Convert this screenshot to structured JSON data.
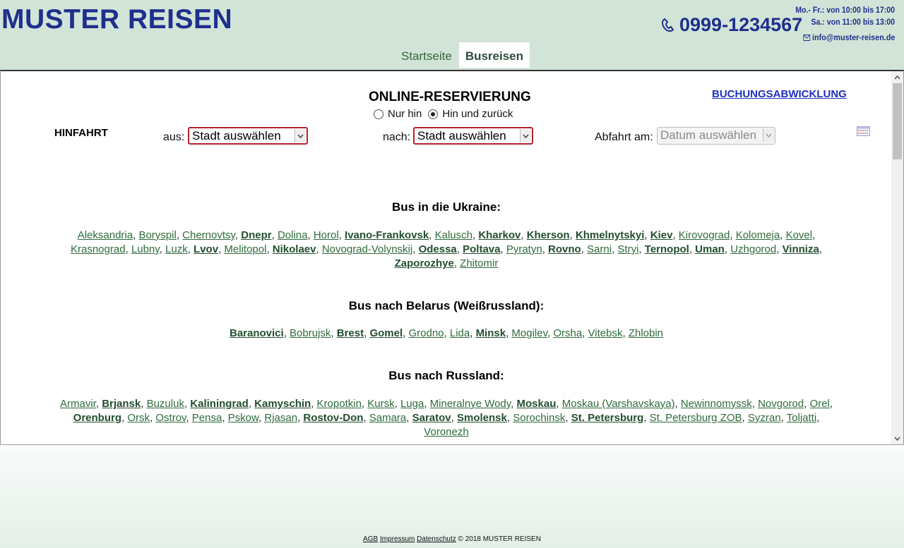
{
  "header": {
    "logo": "MUSTER REISEN",
    "phone": "0999-1234567",
    "hours_weekday": "Mo.- Fr.: von 10:00 bis 17:00",
    "hours_saturday": "Sa.: von 11:00 bis 13:00",
    "email": "info@muster-reisen.de",
    "tabs": [
      {
        "label": "Startseite",
        "active": false
      },
      {
        "label": "Busreisen",
        "active": true
      }
    ]
  },
  "reservation": {
    "title": "ONLINE-RESERVIERUNG",
    "booking_link": "BUCHUNGSABWICKLUNG",
    "trip_options": [
      {
        "label": "Nur hin",
        "checked": false
      },
      {
        "label": "Hin und zurück",
        "checked": true
      }
    ],
    "direction_label": "HINFAHRT",
    "from_label": "aus:",
    "from_value": "Stadt auswählen",
    "to_label": "nach:",
    "to_value": "Stadt auswählen",
    "date_label": "Abfahrt am:",
    "date_value": "Datum auswählen",
    "select_border_color": "#b3242d"
  },
  "sections": [
    {
      "title": "Bus in die Ukraine:",
      "cities": [
        {
          "name": "Aleksandria",
          "bold": false
        },
        {
          "name": "Boryspil",
          "bold": false
        },
        {
          "name": "Chernovtsy",
          "bold": false
        },
        {
          "name": "Dnepr",
          "bold": true
        },
        {
          "name": "Dolina",
          "bold": false
        },
        {
          "name": "Horol",
          "bold": false
        },
        {
          "name": "Ivano-Frankovsk",
          "bold": true
        },
        {
          "name": "Kalusch",
          "bold": false
        },
        {
          "name": "Kharkov",
          "bold": true
        },
        {
          "name": "Kherson",
          "bold": true
        },
        {
          "name": "Khmelnytskyi",
          "bold": true
        },
        {
          "name": "Kiev",
          "bold": true
        },
        {
          "name": "Kirovograd",
          "bold": false
        },
        {
          "name": "Kolomeja",
          "bold": false
        },
        {
          "name": "Kovel",
          "bold": false
        },
        {
          "name": "Krasnograd",
          "bold": false
        },
        {
          "name": "Lubny",
          "bold": false
        },
        {
          "name": "Luzk",
          "bold": false
        },
        {
          "name": "Lvov",
          "bold": true
        },
        {
          "name": "Melitopol",
          "bold": false
        },
        {
          "name": "Nikolaev",
          "bold": true
        },
        {
          "name": "Novograd-Volynskij",
          "bold": false
        },
        {
          "name": "Odessa",
          "bold": true
        },
        {
          "name": "Poltava",
          "bold": true
        },
        {
          "name": "Pyratyn",
          "bold": false
        },
        {
          "name": "Rovno",
          "bold": true
        },
        {
          "name": "Sarni",
          "bold": false
        },
        {
          "name": "Stryi",
          "bold": false
        },
        {
          "name": "Ternopol",
          "bold": true
        },
        {
          "name": "Uman",
          "bold": true
        },
        {
          "name": "Uzhgorod",
          "bold": false
        },
        {
          "name": "Vinniza",
          "bold": true
        },
        {
          "name": "Zaporozhye",
          "bold": true
        },
        {
          "name": "Zhitomir",
          "bold": false
        }
      ]
    },
    {
      "title": "Bus nach Belarus (Weißrussland):",
      "cities": [
        {
          "name": "Baranovici",
          "bold": true
        },
        {
          "name": "Bobrujsk",
          "bold": false
        },
        {
          "name": "Brest",
          "bold": true
        },
        {
          "name": "Gomel",
          "bold": true
        },
        {
          "name": "Grodno",
          "bold": false
        },
        {
          "name": "Lida",
          "bold": false
        },
        {
          "name": "Minsk",
          "bold": true
        },
        {
          "name": "Mogilev",
          "bold": false
        },
        {
          "name": "Orsha",
          "bold": false
        },
        {
          "name": "Vitebsk",
          "bold": false
        },
        {
          "name": "Zhlobin",
          "bold": false
        }
      ]
    },
    {
      "title": "Bus nach Russland:",
      "cities": [
        {
          "name": "Armavir",
          "bold": false
        },
        {
          "name": "Brjansk",
          "bold": true
        },
        {
          "name": "Buzuluk",
          "bold": false
        },
        {
          "name": "Kaliningrad",
          "bold": true
        },
        {
          "name": "Kamyschin",
          "bold": true
        },
        {
          "name": "Kropotkin",
          "bold": false
        },
        {
          "name": "Kursk",
          "bold": false
        },
        {
          "name": "Luga",
          "bold": false
        },
        {
          "name": "Mineralnye Wody",
          "bold": false
        },
        {
          "name": "Moskau",
          "bold": true
        },
        {
          "name": "Moskau (Varshavskaya)",
          "bold": false
        },
        {
          "name": "Newinnomyssk",
          "bold": false
        },
        {
          "name": "Novgorod",
          "bold": false
        },
        {
          "name": "Orel",
          "bold": false
        },
        {
          "name": "Orenburg",
          "bold": true
        },
        {
          "name": "Orsk",
          "bold": false
        },
        {
          "name": "Ostrov",
          "bold": false
        },
        {
          "name": "Pensa",
          "bold": false
        },
        {
          "name": "Pskow",
          "bold": false
        },
        {
          "name": "Rjasan",
          "bold": false
        },
        {
          "name": "Rostov-Don",
          "bold": true
        },
        {
          "name": "Samara",
          "bold": false
        },
        {
          "name": "Saratov",
          "bold": true
        },
        {
          "name": "Smolensk",
          "bold": true
        },
        {
          "name": "Sorochinsk",
          "bold": false
        },
        {
          "name": "St. Petersburg",
          "bold": true
        },
        {
          "name": "St. Petersburg ZOB",
          "bold": false
        },
        {
          "name": "Syzran",
          "bold": false
        },
        {
          "name": "Toljatti",
          "bold": false
        },
        {
          "name": "Voronezh",
          "bold": false
        }
      ]
    }
  ],
  "footer": {
    "links": [
      "AGB",
      "Impressum",
      "Datenschutz"
    ],
    "copyright": "© 2018 MUSTER REISEN"
  }
}
